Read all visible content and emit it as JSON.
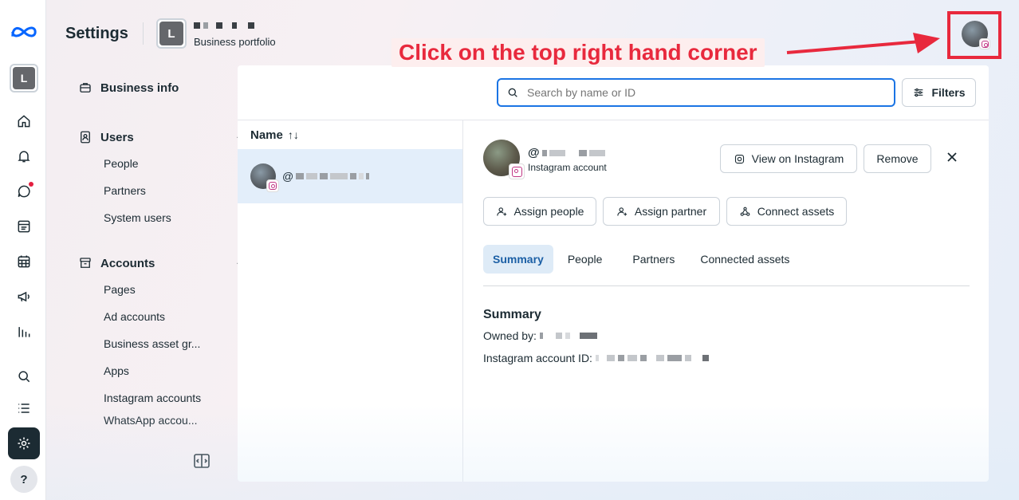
{
  "app": {
    "title": "Settings",
    "portfolio_initial": "L",
    "portfolio_subtitle": "Business portfolio"
  },
  "rail": {
    "account_initial": "L",
    "help_label": "?"
  },
  "nav": {
    "business_info": "Business info",
    "users": {
      "label": "Users",
      "items": [
        "People",
        "Partners",
        "System users"
      ]
    },
    "accounts": {
      "label": "Accounts",
      "items": [
        "Pages",
        "Ad accounts",
        "Business asset gr...",
        "Apps",
        "Instagram accounts",
        "WhatsApp accou..."
      ]
    }
  },
  "search": {
    "placeholder": "Search by name or ID"
  },
  "filters_label": "Filters",
  "list": {
    "column_header": "Name",
    "sort_icon": "↑↓",
    "row_handle_prefix": "@"
  },
  "detail": {
    "handle_prefix": "@",
    "account_type": "Instagram account",
    "view_button": "View on Instagram",
    "remove_button": "Remove",
    "assign_people": "Assign people",
    "assign_partner": "Assign partner",
    "connect_assets": "Connect assets",
    "tabs": [
      "Summary",
      "People",
      "Partners",
      "Connected assets"
    ],
    "summary_title": "Summary",
    "owned_by_label": "Owned by:",
    "ig_id_label": "Instagram account ID:"
  },
  "annotation": {
    "callout_text": "Click on the top right hand corner",
    "color": "#e8293d"
  },
  "colors": {
    "accent": "#1b74e4",
    "active_tab_bg": "#deebf7",
    "selected_row_bg": "#e3eefa"
  }
}
